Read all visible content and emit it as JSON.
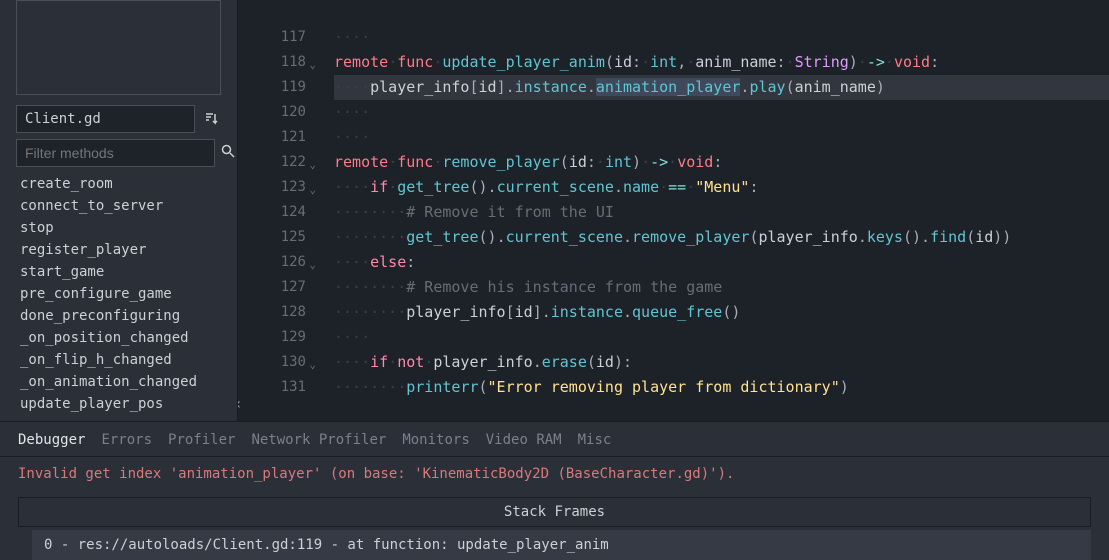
{
  "sidebar": {
    "script_name": "Client.gd",
    "filter_placeholder": "Filter methods",
    "methods": [
      "create_room",
      "connect_to_server",
      "stop",
      "register_player",
      "start_game",
      "pre_configure_game",
      "done_preconfiguring",
      "_on_position_changed",
      "_on_flip_h_changed",
      "_on_animation_changed",
      "update_player_pos"
    ]
  },
  "code": {
    "lines": [
      {
        "n": "",
        "html": ""
      },
      {
        "n": "117",
        "html": "<span class='ws'>····</span>"
      },
      {
        "n": "118",
        "fold": true,
        "html": "<span class='kw-remote'>remote</span><span class='ws'>·</span><span class='kw-func'>func</span><span class='ws'>·</span><span class='fn-name'>update_player_anim</span><span class='punct'>(</span><span class='ident'>id</span><span class='punct'>:</span><span class='ws'>·</span><span class='type'>int</span><span class='punct'>,</span><span class='ws'>·</span><span class='ident'>anim_name</span><span class='punct'>:</span><span class='ws'>·</span><span class='builtin'>String</span><span class='punct'>)</span><span class='ws'>·</span><span class='op'>-&gt;</span><span class='ws'>·</span><span class='kw-void'>void</span><span class='punct'>:</span>"
      },
      {
        "n": "119",
        "highlight": true,
        "active": true,
        "html": "<span class='ws'>····</span><span class='ident'>player_info</span><span class='punct'>[</span><span class='ident'>id</span><span class='punct'>]</span><span class='punct'>.</span><span class='member'>instance</span><span class='punct'>.</span><span class='member sel'>animation_player</span><span class='punct'>.</span><span class='call'>play</span><span class='punct'>(</span><span class='ident'>anim_name</span><span class='punct'>)</span>"
      },
      {
        "n": "120",
        "html": "<span class='ws'>····</span>"
      },
      {
        "n": "121",
        "html": "<span class='ws'>····</span>"
      },
      {
        "n": "122",
        "fold": true,
        "html": "<span class='kw-remote'>remote</span><span class='ws'>·</span><span class='kw-func'>func</span><span class='ws'>·</span><span class='fn-name'>remove_player</span><span class='punct'>(</span><span class='ident'>id</span><span class='punct'>:</span><span class='ws'>·</span><span class='type'>int</span><span class='punct'>)</span><span class='ws'>·</span><span class='op'>-&gt;</span><span class='ws'>·</span><span class='kw-void'>void</span><span class='punct'>:</span>"
      },
      {
        "n": "123",
        "fold": true,
        "html": "<span class='ws'>····</span><span class='kw-if'>if</span><span class='ws'>·</span><span class='call'>get_tree</span><span class='punct'>()</span><span class='punct'>.</span><span class='member'>current_scene</span><span class='punct'>.</span><span class='member'>name</span><span class='ws'>·</span><span class='op'>==</span><span class='ws'>·</span><span class='string'>\"Menu\"</span><span class='punct'>:</span>"
      },
      {
        "n": "124",
        "html": "<span class='ws'>········</span><span class='comment'># Remove it from the UI</span>"
      },
      {
        "n": "125",
        "html": "<span class='ws'>········</span><span class='call'>get_tree</span><span class='punct'>()</span><span class='punct'>.</span><span class='member'>current_scene</span><span class='punct'>.</span><span class='call'>remove_player</span><span class='punct'>(</span><span class='ident'>player_info</span><span class='punct'>.</span><span class='call'>keys</span><span class='punct'>()</span><span class='punct'>.</span><span class='call'>find</span><span class='punct'>(</span><span class='ident'>id</span><span class='punct'>))</span>"
      },
      {
        "n": "126",
        "fold": true,
        "html": "<span class='ws'>····</span><span class='kw-else'>else</span><span class='punct'>:</span>"
      },
      {
        "n": "127",
        "html": "<span class='ws'>········</span><span class='comment'># Remove his instance from the game</span>"
      },
      {
        "n": "128",
        "html": "<span class='ws'>········</span><span class='ident'>player_info</span><span class='punct'>[</span><span class='ident'>id</span><span class='punct'>]</span><span class='punct'>.</span><span class='member'>instance</span><span class='punct'>.</span><span class='call'>queue_free</span><span class='punct'>()</span>"
      },
      {
        "n": "129",
        "html": "<span class='ws'>····</span>"
      },
      {
        "n": "130",
        "fold": true,
        "html": "<span class='ws'>····</span><span class='kw-if'>if</span><span class='ws'>·</span><span class='kw-not'>not</span><span class='ws'>·</span><span class='ident'>player_info</span><span class='punct'>.</span><span class='call'>erase</span><span class='punct'>(</span><span class='ident'>id</span><span class='punct'>)</span><span class='punct'>:</span>"
      },
      {
        "n": "131",
        "html": "<span class='ws'>········</span><span class='call'>printerr</span><span class='punct'>(</span><span class='string'>\"Error removing player from dictionary\"</span><span class='punct'>)</span>"
      }
    ]
  },
  "debugger": {
    "tabs": [
      "Debugger",
      "Errors",
      "Profiler",
      "Network Profiler",
      "Monitors",
      "Video RAM",
      "Misc"
    ],
    "active_tab": 0,
    "error": "Invalid get index 'animation_player' (on base: 'KinematicBody2D (BaseCharacter.gd)').",
    "stack_header": "Stack Frames",
    "stack_frames": [
      "0 - res://autoloads/Client.gd:119 - at function: update_player_anim"
    ]
  }
}
